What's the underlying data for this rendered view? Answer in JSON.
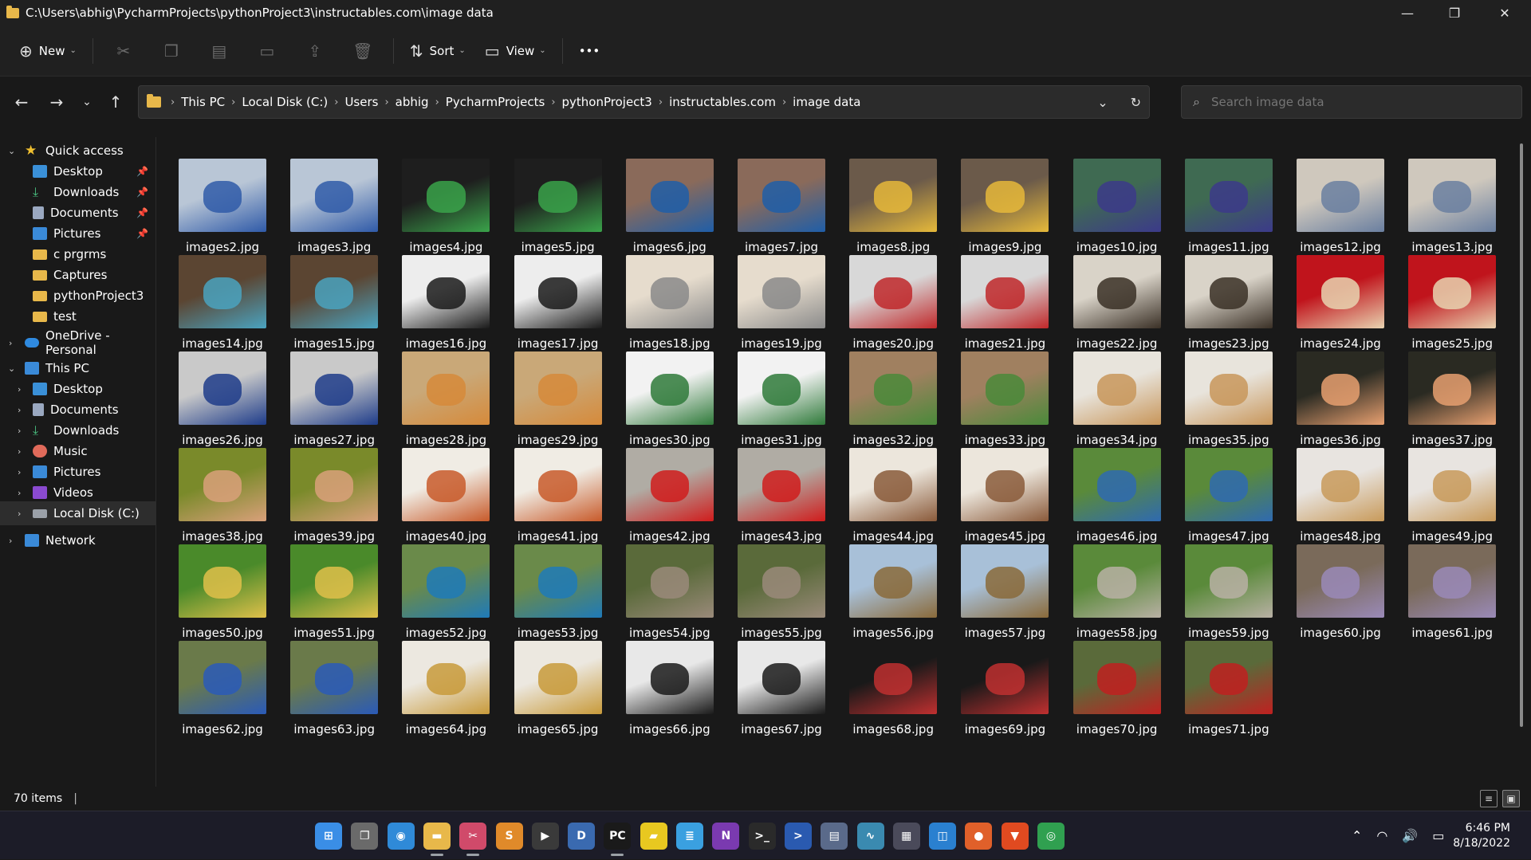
{
  "window": {
    "title_path": "C:\\Users\\abhig\\PycharmProjects\\pythonProject3\\instructables.com\\image data",
    "minimize": "—",
    "maximize": "❐",
    "close": "✕"
  },
  "toolbar": {
    "new_label": "New",
    "sort_label": "Sort",
    "view_label": "View",
    "more_label": "•••"
  },
  "address": {
    "crumbs": [
      "This PC",
      "Local Disk (C:)",
      "Users",
      "abhig",
      "PycharmProjects",
      "pythonProject3",
      "instructables.com",
      "image data"
    ]
  },
  "search": {
    "placeholder": "Search image data"
  },
  "sidebar": {
    "items": [
      {
        "label": "Quick access"
      },
      {
        "label": "Desktop"
      },
      {
        "label": "Downloads"
      },
      {
        "label": "Documents"
      },
      {
        "label": "Pictures"
      },
      {
        "label": "c prgrms"
      },
      {
        "label": "Captures"
      },
      {
        "label": "pythonProject3"
      },
      {
        "label": "test"
      },
      {
        "label": "OneDrive - Personal"
      },
      {
        "label": "This PC"
      },
      {
        "label": "Desktop"
      },
      {
        "label": "Documents"
      },
      {
        "label": "Downloads"
      },
      {
        "label": "Music"
      },
      {
        "label": "Pictures"
      },
      {
        "label": "Videos"
      },
      {
        "label": "Local Disk (C:)"
      },
      {
        "label": "Network"
      }
    ]
  },
  "files": [
    {
      "name": "images2.jpg",
      "c1": "#b9c6d6",
      "c2": "#2f5aa8"
    },
    {
      "name": "images3.jpg",
      "c1": "#b9c6d6",
      "c2": "#2f5aa8"
    },
    {
      "name": "images4.jpg",
      "c1": "#1e1e1e",
      "c2": "#3aa34a"
    },
    {
      "name": "images5.jpg",
      "c1": "#1e1e1e",
      "c2": "#3aa34a"
    },
    {
      "name": "images6.jpg",
      "c1": "#8a6a5a",
      "c2": "#1f5ea8"
    },
    {
      "name": "images7.jpg",
      "c1": "#8a6a5a",
      "c2": "#1f5ea8"
    },
    {
      "name": "images8.jpg",
      "c1": "#6b5a4a",
      "c2": "#e6b93a"
    },
    {
      "name": "images9.jpg",
      "c1": "#6b5a4a",
      "c2": "#e6b93a"
    },
    {
      "name": "images10.jpg",
      "c1": "#3f6a52",
      "c2": "#3c3a8a"
    },
    {
      "name": "images11.jpg",
      "c1": "#3f6a52",
      "c2": "#3c3a8a"
    },
    {
      "name": "images12.jpg",
      "c1": "#cfc8bd",
      "c2": "#6a7fa0"
    },
    {
      "name": "images13.jpg",
      "c1": "#cfc8bd",
      "c2": "#6a7fa0"
    },
    {
      "name": "images14.jpg",
      "c1": "#5b4532",
      "c2": "#4aa3c0"
    },
    {
      "name": "images15.jpg",
      "c1": "#5b4532",
      "c2": "#4aa3c0"
    },
    {
      "name": "images16.jpg",
      "c1": "#ededed",
      "c2": "#1a1a1a"
    },
    {
      "name": "images17.jpg",
      "c1": "#ededed",
      "c2": "#1a1a1a"
    },
    {
      "name": "images18.jpg",
      "c1": "#e6dccd",
      "c2": "#8a8a8a"
    },
    {
      "name": "images19.jpg",
      "c1": "#e6dccd",
      "c2": "#8a8a8a"
    },
    {
      "name": "images20.jpg",
      "c1": "#d8d8d8",
      "c2": "#c0282a"
    },
    {
      "name": "images21.jpg",
      "c1": "#d8d8d8",
      "c2": "#c0282a"
    },
    {
      "name": "images22.jpg",
      "c1": "#d9d3c8",
      "c2": "#3a3026"
    },
    {
      "name": "images23.jpg",
      "c1": "#d9d3c8",
      "c2": "#3a3026"
    },
    {
      "name": "images24.jpg",
      "c1": "#c0141c",
      "c2": "#e8d3b0"
    },
    {
      "name": "images25.jpg",
      "c1": "#c0141c",
      "c2": "#e8d3b0"
    },
    {
      "name": "images26.jpg",
      "c1": "#c9c9c9",
      "c2": "#1e3c8a"
    },
    {
      "name": "images27.jpg",
      "c1": "#c9c9c9",
      "c2": "#1e3c8a"
    },
    {
      "name": "images28.jpg",
      "c1": "#c9a878",
      "c2": "#d68a3a"
    },
    {
      "name": "images29.jpg",
      "c1": "#c9a878",
      "c2": "#d68a3a"
    },
    {
      "name": "images30.jpg",
      "c1": "#f2f2f2",
      "c2": "#2f7a3a"
    },
    {
      "name": "images31.jpg",
      "c1": "#f2f2f2",
      "c2": "#2f7a3a"
    },
    {
      "name": "images32.jpg",
      "c1": "#a08060",
      "c2": "#4a8a3a"
    },
    {
      "name": "images33.jpg",
      "c1": "#a08060",
      "c2": "#4a8a3a"
    },
    {
      "name": "images34.jpg",
      "c1": "#e8e4dc",
      "c2": "#c8965a"
    },
    {
      "name": "images35.jpg",
      "c1": "#e8e4dc",
      "c2": "#c8965a"
    },
    {
      "name": "images36.jpg",
      "c1": "#2a2a22",
      "c2": "#e8a070"
    },
    {
      "name": "images37.jpg",
      "c1": "#2a2a22",
      "c2": "#e8a070"
    },
    {
      "name": "images38.jpg",
      "c1": "#7a8a2a",
      "c2": "#d9a07a"
    },
    {
      "name": "images39.jpg",
      "c1": "#7a8a2a",
      "c2": "#d9a07a"
    },
    {
      "name": "images40.jpg",
      "c1": "#f0ece4",
      "c2": "#c85a2a"
    },
    {
      "name": "images41.jpg",
      "c1": "#f0ece4",
      "c2": "#c85a2a"
    },
    {
      "name": "images42.jpg",
      "c1": "#b0aca4",
      "c2": "#d01c1c"
    },
    {
      "name": "images43.jpg",
      "c1": "#b0aca4",
      "c2": "#d01c1c"
    },
    {
      "name": "images44.jpg",
      "c1": "#ece6dc",
      "c2": "#8a5a3a"
    },
    {
      "name": "images45.jpg",
      "c1": "#ece6dc",
      "c2": "#8a5a3a"
    },
    {
      "name": "images46.jpg",
      "c1": "#5a8a3a",
      "c2": "#2f6ab0"
    },
    {
      "name": "images47.jpg",
      "c1": "#5a8a3a",
      "c2": "#2f6ab0"
    },
    {
      "name": "images48.jpg",
      "c1": "#e8e4e0",
      "c2": "#c89a5a"
    },
    {
      "name": "images49.jpg",
      "c1": "#e8e4e0",
      "c2": "#c89a5a"
    },
    {
      "name": "images50.jpg",
      "c1": "#4a8a2a",
      "c2": "#e0c04a"
    },
    {
      "name": "images51.jpg",
      "c1": "#4a8a2a",
      "c2": "#e0c04a"
    },
    {
      "name": "images52.jpg",
      "c1": "#6a8a4a",
      "c2": "#1f7ab8"
    },
    {
      "name": "images53.jpg",
      "c1": "#6a8a4a",
      "c2": "#1f7ab8"
    },
    {
      "name": "images54.jpg",
      "c1": "#5a6a3a",
      "c2": "#9a8a7a"
    },
    {
      "name": "images55.jpg",
      "c1": "#5a6a3a",
      "c2": "#9a8a7a"
    },
    {
      "name": "images56.jpg",
      "c1": "#a8c0d8",
      "c2": "#8a6a3a"
    },
    {
      "name": "images57.jpg",
      "c1": "#a8c0d8",
      "c2": "#8a6a3a"
    },
    {
      "name": "images58.jpg",
      "c1": "#5a8a3a",
      "c2": "#b8b0a4"
    },
    {
      "name": "images59.jpg",
      "c1": "#5a8a3a",
      "c2": "#b8b0a4"
    },
    {
      "name": "images60.jpg",
      "c1": "#7a6a5a",
      "c2": "#9a8ab8"
    },
    {
      "name": "images61.jpg",
      "c1": "#7a6a5a",
      "c2": "#9a8ab8"
    },
    {
      "name": "images62.jpg",
      "c1": "#6a7a4a",
      "c2": "#2a5ab8"
    },
    {
      "name": "images63.jpg",
      "c1": "#6a7a4a",
      "c2": "#2a5ab8"
    },
    {
      "name": "images64.jpg",
      "c1": "#ece8e0",
      "c2": "#c89a3a"
    },
    {
      "name": "images65.jpg",
      "c1": "#ece8e0",
      "c2": "#c89a3a"
    },
    {
      "name": "images66.jpg",
      "c1": "#e8e8e8",
      "c2": "#1a1a1a"
    },
    {
      "name": "images67.jpg",
      "c1": "#e8e8e8",
      "c2": "#1a1a1a"
    },
    {
      "name": "images68.jpg",
      "c1": "#191919",
      "c2": "#c03030"
    },
    {
      "name": "images69.jpg",
      "c1": "#191919",
      "c2": "#c03030"
    },
    {
      "name": "images70.jpg",
      "c1": "#5a6a3a",
      "c2": "#c02020"
    },
    {
      "name": "images71.jpg",
      "c1": "#5a6a3a",
      "c2": "#c02020"
    }
  ],
  "status": {
    "count": "70 items",
    "bar": "|"
  },
  "taskbar": {
    "apps": [
      {
        "name": "start-icon",
        "color": "#3a8ee6",
        "glyph": "⊞"
      },
      {
        "name": "task-view-icon",
        "color": "#6a6a6a",
        "glyph": "❐"
      },
      {
        "name": "browser-globe-icon",
        "color": "#2f8ad8",
        "glyph": "◉"
      },
      {
        "name": "file-explorer-icon",
        "color": "#e8b84a",
        "glyph": "▬"
      },
      {
        "name": "snipping-tool-icon",
        "color": "#d04a6a",
        "glyph": "✂"
      },
      {
        "name": "sublime-text-icon",
        "color": "#e08a2a",
        "glyph": "S"
      },
      {
        "name": "media-player-icon",
        "color": "#3a3a3a",
        "glyph": "▶"
      },
      {
        "name": "dev-tools-icon",
        "color": "#3a6ab0",
        "glyph": "D"
      },
      {
        "name": "pycharm-icon",
        "color": "#1a1a1a",
        "glyph": "PC"
      },
      {
        "name": "sticky-notes-icon",
        "color": "#e8c820",
        "glyph": "▰"
      },
      {
        "name": "notepad-icon",
        "color": "#3aa0e0",
        "glyph": "≣"
      },
      {
        "name": "onenote-icon",
        "color": "#7a3ab0",
        "glyph": "N"
      },
      {
        "name": "terminal-icon",
        "color": "#2a2a2a",
        "glyph": ">_"
      },
      {
        "name": "powershell-icon",
        "color": "#2a5ab0",
        "glyph": ">"
      },
      {
        "name": "server-icon",
        "color": "#5a6a8a",
        "glyph": "▤"
      },
      {
        "name": "resource-monitor-icon",
        "color": "#3a8ab0",
        "glyph": "∿"
      },
      {
        "name": "calculator-icon",
        "color": "#4a4a5a",
        "glyph": "▦"
      },
      {
        "name": "remote-desktop-icon",
        "color": "#2a80d0",
        "glyph": "◫"
      },
      {
        "name": "firefox-icon",
        "color": "#e0602a",
        "glyph": "●"
      },
      {
        "name": "brave-icon",
        "color": "#e04a20",
        "glyph": "▼"
      },
      {
        "name": "chrome-icon",
        "color": "#30a050",
        "glyph": "◎"
      }
    ],
    "time": "6:46 PM",
    "date": "8/18/2022"
  }
}
